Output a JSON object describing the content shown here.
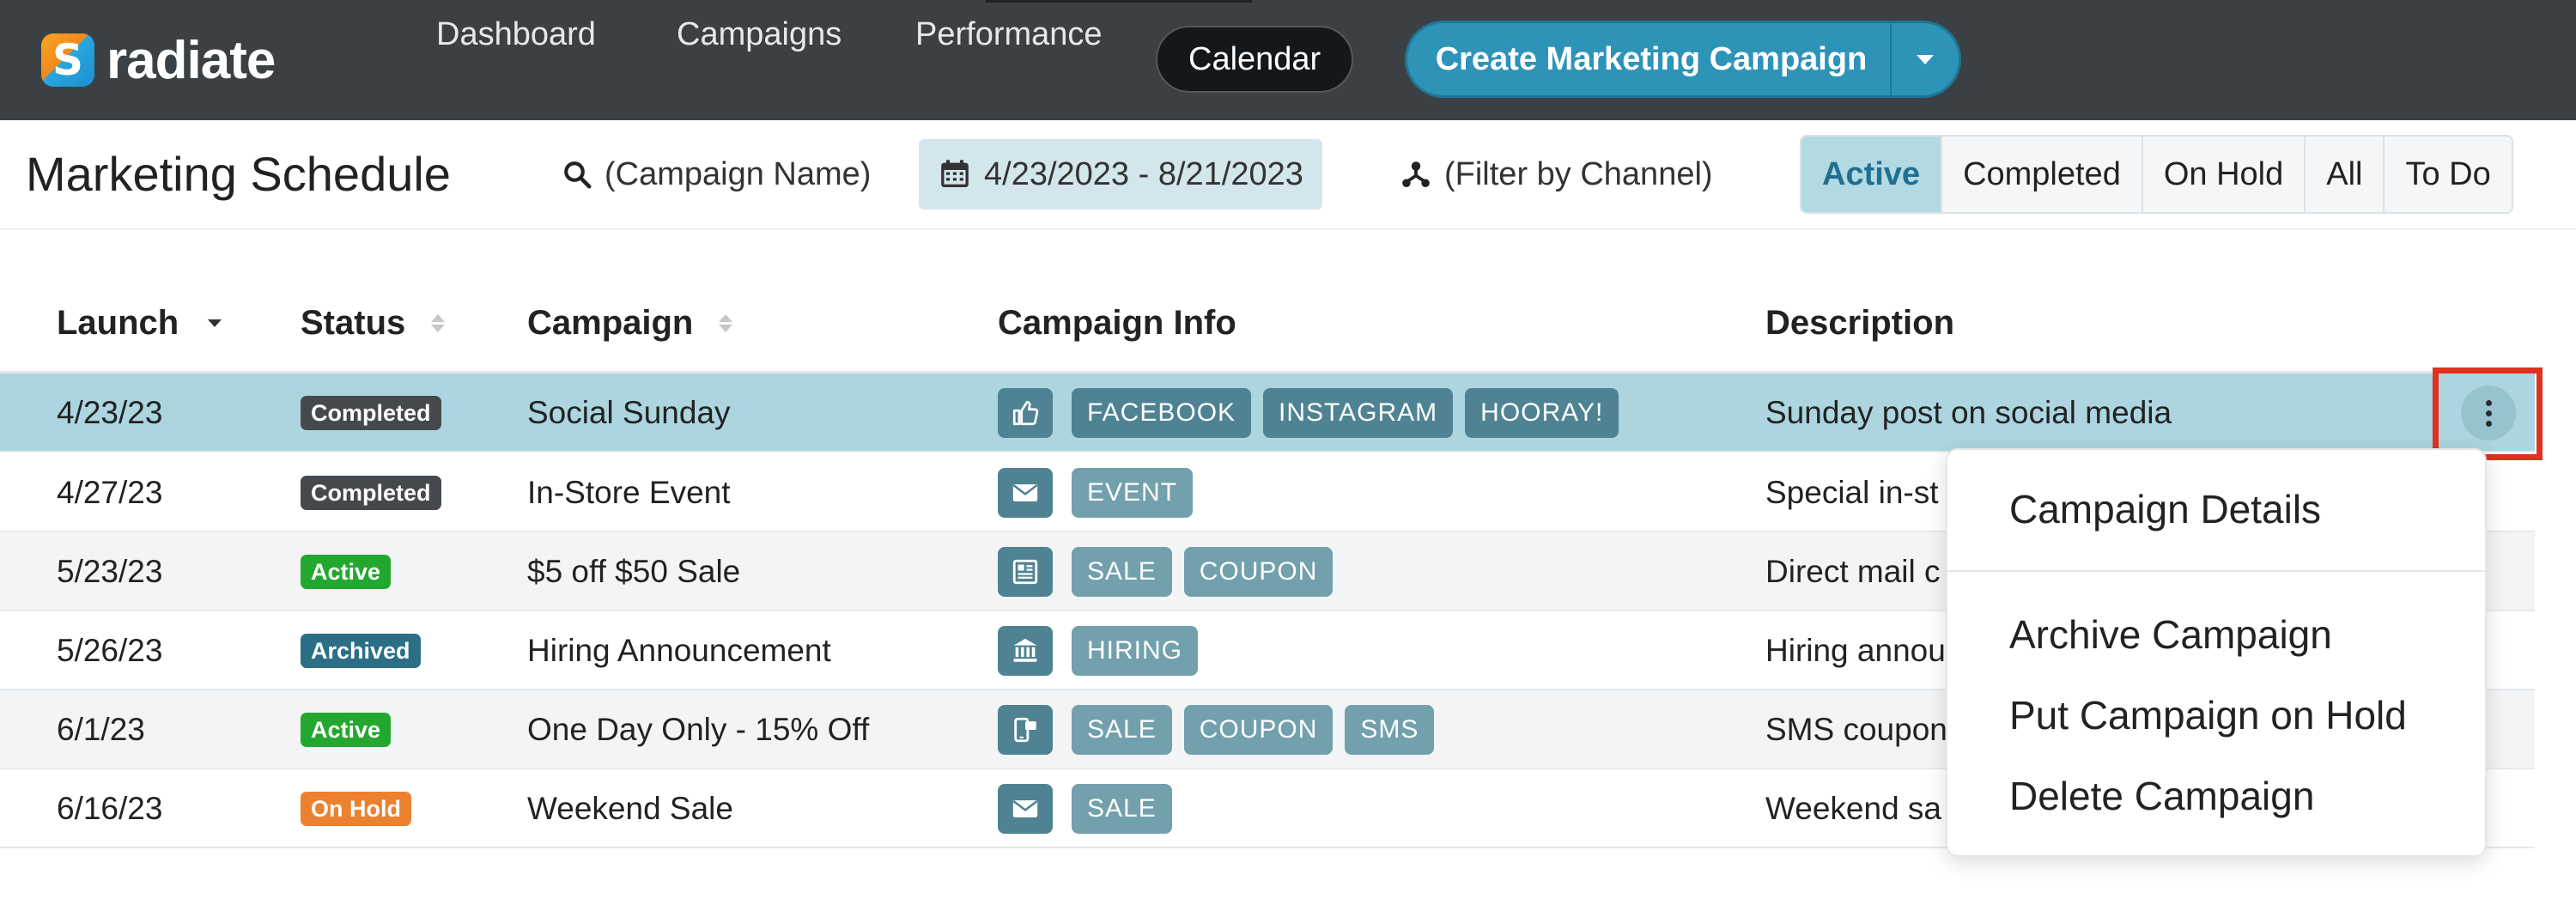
{
  "app": {
    "name": "radiate"
  },
  "nav": {
    "items": [
      {
        "label": "Dashboard"
      },
      {
        "label": "Campaigns"
      },
      {
        "label": "Performance"
      },
      {
        "label": "Calendar"
      }
    ],
    "active": "Calendar",
    "cta_label": "Create Marketing Campaign"
  },
  "toolbar": {
    "title": "Marketing Schedule",
    "search_placeholder": "(Campaign Name)",
    "date_range": "4/23/2023 - 8/21/2023",
    "channel_filter": "(Filter by Channel)",
    "filters": [
      "Active",
      "Completed",
      "On Hold",
      "All",
      "To Do"
    ],
    "active_filter": "Active"
  },
  "table": {
    "columns": [
      "Launch",
      "Status",
      "Campaign",
      "Campaign Info",
      "Description"
    ],
    "rows": [
      {
        "launch": "4/23/23",
        "status": "Completed",
        "campaign": "Social Sunday",
        "icon": "thumbs-up-icon",
        "tags": [
          "FACEBOOK",
          "INSTAGRAM",
          "HOORAY!"
        ],
        "description": "Sunday post on social media"
      },
      {
        "launch": "4/27/23",
        "status": "Completed",
        "campaign": "In-Store Event",
        "icon": "envelope-icon",
        "tags": [
          "EVENT"
        ],
        "description": "Special in-st"
      },
      {
        "launch": "5/23/23",
        "status": "Active",
        "campaign": "$5 off $50 Sale",
        "icon": "newspaper-icon",
        "tags": [
          "SALE",
          "COUPON"
        ],
        "description": "Direct mail c"
      },
      {
        "launch": "5/26/23",
        "status": "Archived",
        "campaign": "Hiring Announcement",
        "icon": "bank-icon",
        "tags": [
          "HIRING"
        ],
        "description": "Hiring annou"
      },
      {
        "launch": "6/1/23",
        "status": "Active",
        "campaign": "One Day Only - 15% Off",
        "icon": "phone-icon",
        "tags": [
          "SALE",
          "COUPON",
          "SMS"
        ],
        "description": "SMS coupon"
      },
      {
        "launch": "6/16/23",
        "status": "On Hold",
        "campaign": "Weekend Sale",
        "icon": "envelope-icon",
        "tags": [
          "SALE"
        ],
        "description": "Weekend sa"
      }
    ]
  },
  "menu": {
    "items": [
      "Campaign Details",
      "Archive Campaign",
      "Put Campaign on Hold",
      "Delete Campaign"
    ]
  },
  "colors": {
    "topbar": "#3b4044",
    "accent": "#2d94b8",
    "selected_row": "#acd5df",
    "status_completed": "#45494d",
    "status_active": "#22a82e",
    "status_archived": "#2a6f85",
    "status_on_hold": "#ec8130",
    "icon_tile": "#4f8393",
    "tag": "#72a0ad",
    "highlight": "#e0301e"
  }
}
